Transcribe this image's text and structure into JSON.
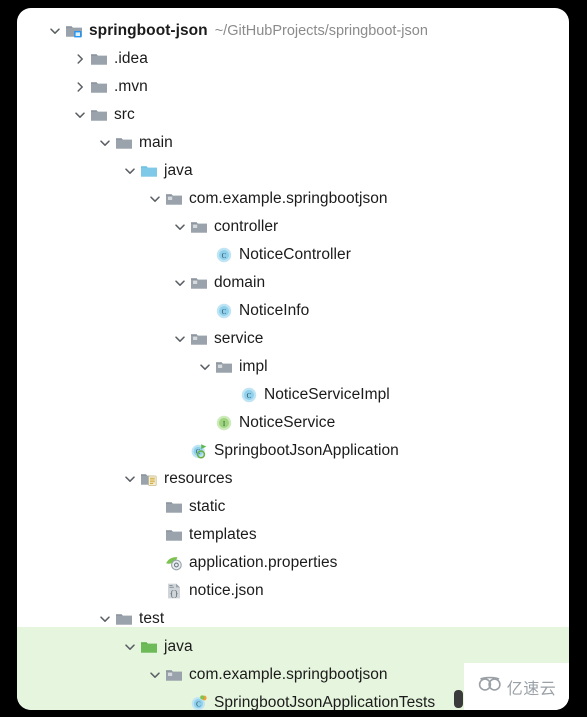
{
  "panel": {
    "background": "#ffffff",
    "selection_color": "#e6f5dd",
    "outer_background": "#000000"
  },
  "project": {
    "name": "springboot-json",
    "path": "~/GitHubProjects/springboot-json"
  },
  "colors": {
    "folder_gray": "#9aa3ab",
    "folder_blue": "#7fc9e8",
    "folder_green": "#6cbb58",
    "class_blue": "#8fd1ec",
    "interface_green": "#9ed47d",
    "text": "#1b1b1b",
    "path_text": "#8b8b8b"
  },
  "tree": [
    {
      "label": "springboot-json",
      "path": "~/GitHubProjects/springboot-json",
      "icon": "module-folder-icon",
      "twisty": "expanded",
      "depth": 0,
      "bold": true,
      "selected": false
    },
    {
      "label": ".idea",
      "path": "",
      "icon": "folder-icon",
      "twisty": "collapsed",
      "depth": 1,
      "bold": false,
      "selected": false
    },
    {
      "label": ".mvn",
      "path": "",
      "icon": "folder-icon",
      "twisty": "collapsed",
      "depth": 1,
      "bold": false,
      "selected": false
    },
    {
      "label": "src",
      "path": "",
      "icon": "folder-icon",
      "twisty": "expanded",
      "depth": 1,
      "bold": false,
      "selected": false
    },
    {
      "label": "main",
      "path": "",
      "icon": "folder-icon",
      "twisty": "expanded",
      "depth": 2,
      "bold": false,
      "selected": false
    },
    {
      "label": "java",
      "path": "",
      "icon": "source-root-folder-icon",
      "twisty": "expanded",
      "depth": 3,
      "bold": false,
      "selected": false
    },
    {
      "label": "com.example.springbootjson",
      "path": "",
      "icon": "package-icon",
      "twisty": "expanded",
      "depth": 4,
      "bold": false,
      "selected": false
    },
    {
      "label": "controller",
      "path": "",
      "icon": "package-icon",
      "twisty": "expanded",
      "depth": 5,
      "bold": false,
      "selected": false
    },
    {
      "label": "NoticeController",
      "path": "",
      "icon": "java-class-icon",
      "twisty": "none",
      "depth": 6,
      "bold": false,
      "selected": false
    },
    {
      "label": "domain",
      "path": "",
      "icon": "package-icon",
      "twisty": "expanded",
      "depth": 5,
      "bold": false,
      "selected": false
    },
    {
      "label": "NoticeInfo",
      "path": "",
      "icon": "java-class-icon",
      "twisty": "none",
      "depth": 6,
      "bold": false,
      "selected": false
    },
    {
      "label": "service",
      "path": "",
      "icon": "package-icon",
      "twisty": "expanded",
      "depth": 5,
      "bold": false,
      "selected": false
    },
    {
      "label": "impl",
      "path": "",
      "icon": "package-icon",
      "twisty": "expanded",
      "depth": 6,
      "bold": false,
      "selected": false
    },
    {
      "label": "NoticeServiceImpl",
      "path": "",
      "icon": "java-class-icon",
      "twisty": "none",
      "depth": 7,
      "bold": false,
      "selected": false
    },
    {
      "label": "NoticeService",
      "path": "",
      "icon": "java-interface-icon",
      "twisty": "none",
      "depth": 6,
      "bold": false,
      "selected": false
    },
    {
      "label": "SpringbootJsonApplication",
      "path": "",
      "icon": "spring-boot-application-icon",
      "twisty": "none",
      "depth": 5,
      "bold": false,
      "selected": false
    },
    {
      "label": "resources",
      "path": "",
      "icon": "resources-folder-icon",
      "twisty": "expanded",
      "depth": 3,
      "bold": false,
      "selected": false
    },
    {
      "label": "static",
      "path": "",
      "icon": "folder-icon",
      "twisty": "none",
      "depth": 4,
      "bold": false,
      "selected": false
    },
    {
      "label": "templates",
      "path": "",
      "icon": "folder-icon",
      "twisty": "none",
      "depth": 4,
      "bold": false,
      "selected": false
    },
    {
      "label": "application.properties",
      "path": "",
      "icon": "spring-properties-file-icon",
      "twisty": "none",
      "depth": 4,
      "bold": false,
      "selected": false
    },
    {
      "label": "notice.json",
      "path": "",
      "icon": "json-file-icon",
      "twisty": "none",
      "depth": 4,
      "bold": false,
      "selected": false
    },
    {
      "label": "test",
      "path": "",
      "icon": "folder-icon",
      "twisty": "expanded",
      "depth": 2,
      "bold": false,
      "selected": false
    },
    {
      "label": "java",
      "path": "",
      "icon": "test-source-root-folder-icon",
      "twisty": "expanded",
      "depth": 3,
      "bold": false,
      "selected": true
    },
    {
      "label": "com.example.springbootjson",
      "path": "",
      "icon": "package-icon",
      "twisty": "expanded",
      "depth": 4,
      "bold": false,
      "selected": true
    },
    {
      "label": "SpringbootJsonApplicationTests",
      "path": "",
      "icon": "java-test-class-icon",
      "twisty": "none",
      "depth": 5,
      "bold": false,
      "selected": true
    }
  ],
  "watermark": {
    "text": "亿速云",
    "icon": "cloud-logo-icon"
  }
}
